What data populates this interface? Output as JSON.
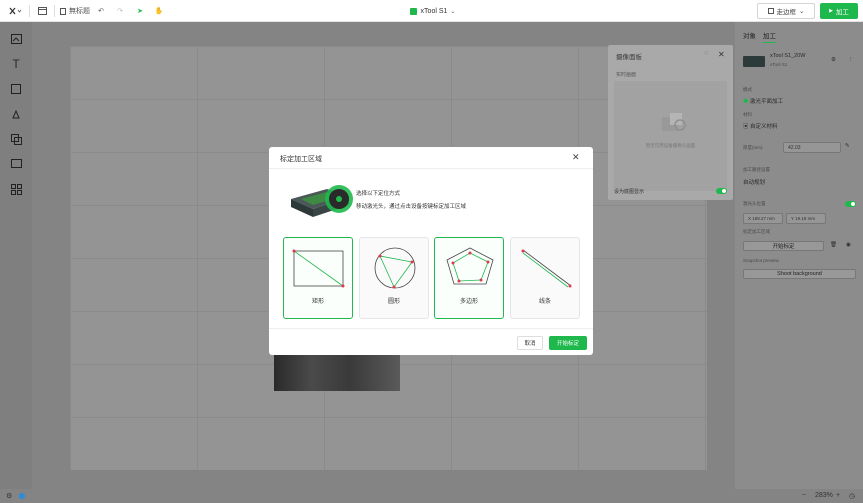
{
  "topbar": {
    "untitled_label": "無标题",
    "device_name": "xTool S1",
    "frame_label": "走边框",
    "process_label": "加工"
  },
  "camera_panel": {
    "title": "摄像面板",
    "subtitle": "实时画面",
    "placeholder_text": "暂无可用设备摄像头画面",
    "toggle_label": "设为底图显示"
  },
  "right_panel": {
    "tabs": [
      "对象",
      "加工"
    ],
    "device_model": "xTool S1_20W",
    "device_sub": "xTool S1",
    "mode_label": "模式",
    "mode_value": "激光平面加工",
    "material_label": "材料",
    "material_value": "自定义材料",
    "thickness_label": "厚度(mm)",
    "thickness_value": "42.03",
    "path_label": "加工路径设置",
    "path_value": "自动规划",
    "pos_label": "激光头位置",
    "x_value": "X 189.27 mm",
    "y_value": "Y 19.18 mm",
    "area_label": "标定加工区域",
    "area_btn": "开始标定",
    "snapshot_label": "Snapshot preview",
    "shoot_btn": "Shoot background"
  },
  "bottombar": {
    "zoom": "283%"
  },
  "modal": {
    "title": "标定加工区域",
    "instruction1": "选择以下定位方式",
    "instruction2": "移动激光头，通过点击设备按键标定加工区域",
    "options": [
      {
        "label": "矩形"
      },
      {
        "label": "圆形"
      },
      {
        "label": "多边形"
      },
      {
        "label": "线条"
      }
    ],
    "cancel_label": "取消",
    "start_label": "开始标定"
  }
}
